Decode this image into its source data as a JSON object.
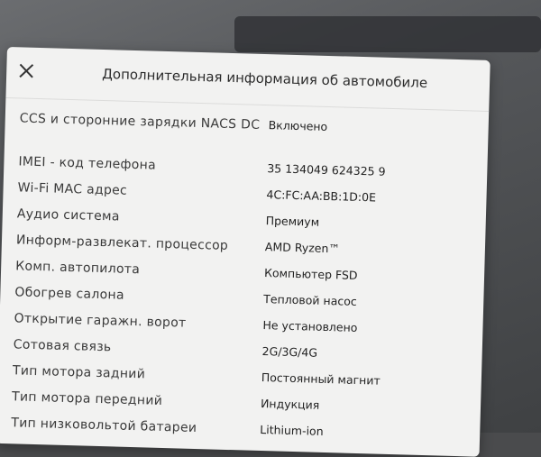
{
  "dialog": {
    "close_glyph": "✕",
    "title": "Дополнительная информация об автомобиле"
  },
  "rows": [
    {
      "label": "CCS и сторонние зарядки NACS DC",
      "value": "Включено"
    },
    {
      "label": "IMEI - код телефона",
      "value": "35 134049 624325 9"
    },
    {
      "label": "Wi-Fi MAC адрес",
      "value": "4C:FC:AA:BB:1D:0E"
    },
    {
      "label": "Аудио система",
      "value": "Премиум"
    },
    {
      "label": "Информ-развлекат. процессор",
      "value": "AMD Ryzen™"
    },
    {
      "label": "Комп. автопилота",
      "value": "Компьютер FSD"
    },
    {
      "label": "Обогрев салона",
      "value": "Тепловой насос"
    },
    {
      "label": "Открытие гаражн. ворот",
      "value": "Не установлено"
    },
    {
      "label": "Сотовая связь",
      "value": "2G/3G/4G"
    },
    {
      "label": "Тип мотора задний",
      "value": "Постоянный магнит"
    },
    {
      "label": "Тип мотора передний",
      "value": "Индукция"
    },
    {
      "label": "Тип низковольтой батареи",
      "value": "Lithium-ion"
    }
  ],
  "icons": {
    "close": "close-icon"
  }
}
